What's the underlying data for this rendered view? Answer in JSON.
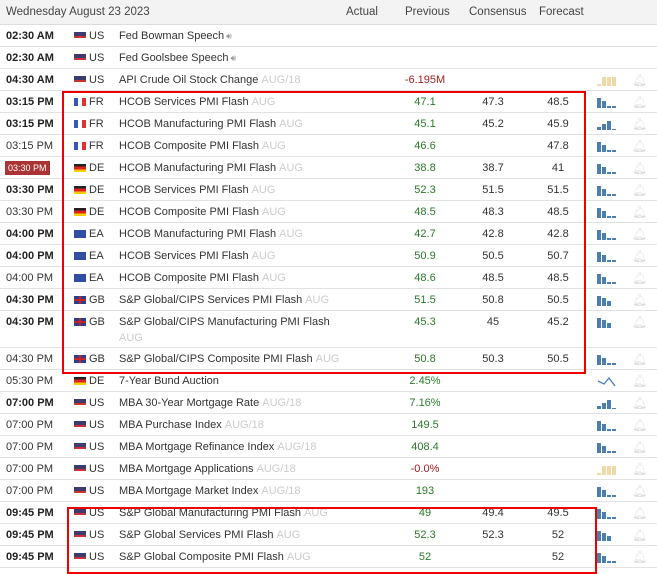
{
  "header": {
    "date": "Wednesday August 23 2023",
    "actual": "Actual",
    "previous": "Previous",
    "consensus": "Consensus",
    "forecast": "Forecast"
  },
  "colors": {
    "highlight_box": "#ee0000",
    "chart_blue": "#4a7fb0",
    "chart_tan": "#f0d9a8",
    "badge": "#aa3333"
  },
  "rows": [
    {
      "time": "02:30 AM",
      "bold": true,
      "cc": "US",
      "event": "Fed Bowman Speech",
      "period": "",
      "speaker": true,
      "previous": "",
      "consensus": "",
      "forecast": "",
      "chart": "none"
    },
    {
      "time": "02:30 AM",
      "bold": true,
      "cc": "US",
      "event": "Fed Goolsbee Speech",
      "period": "",
      "speaker": true,
      "previous": "",
      "consensus": "",
      "forecast": "",
      "chart": "none"
    },
    {
      "time": "04:30 AM",
      "bold": true,
      "cc": "US",
      "event": "API Crude Oil Stock Change",
      "period": "AUG/18",
      "previous": "-6.195M",
      "consensus": "",
      "forecast": "",
      "chart": "tan"
    },
    {
      "time": "03:15 PM",
      "bold": true,
      "cc": "FR",
      "event": "HCOB Services PMI Flash",
      "period": "AUG",
      "previous": "47.1",
      "consensus": "47.3",
      "forecast": "48.5",
      "chart": "bars"
    },
    {
      "time": "03:15 PM",
      "bold": true,
      "cc": "FR",
      "event": "HCOB Manufacturing PMI Flash",
      "period": "AUG",
      "previous": "45.1",
      "consensus": "45.2",
      "forecast": "45.9",
      "chart": "rising"
    },
    {
      "time": "03:15 PM",
      "bold": false,
      "cc": "FR",
      "event": "HCOB Composite PMI Flash",
      "period": "AUG",
      "previous": "46.6",
      "consensus": "",
      "forecast": "47.8",
      "chart": "bars"
    },
    {
      "time": "03:30 PM",
      "badge": true,
      "cc": "DE",
      "event": "HCOB Manufacturing PMI Flash",
      "period": "AUG",
      "previous": "38.8",
      "consensus": "38.7",
      "forecast": "41",
      "chart": "bars"
    },
    {
      "time": "03:30 PM",
      "bold": true,
      "cc": "DE",
      "event": "HCOB Services PMI Flash",
      "period": "AUG",
      "previous": "52.3",
      "consensus": "51.5",
      "forecast": "51.5",
      "chart": "bars"
    },
    {
      "time": "03:30 PM",
      "bold": false,
      "cc": "DE",
      "event": "HCOB Composite PMI Flash",
      "period": "AUG",
      "previous": "48.5",
      "consensus": "48.3",
      "forecast": "48.5",
      "chart": "bars"
    },
    {
      "time": "04:00 PM",
      "bold": true,
      "cc": "EA",
      "event": "HCOB Manufacturing PMI Flash",
      "period": "AUG",
      "previous": "42.7",
      "consensus": "42.8",
      "forecast": "42.8",
      "chart": "bars"
    },
    {
      "time": "04:00 PM",
      "bold": true,
      "cc": "EA",
      "event": "HCOB Services PMI Flash",
      "period": "AUG",
      "previous": "50.9",
      "consensus": "50.5",
      "forecast": "50.7",
      "chart": "bars"
    },
    {
      "time": "04:00 PM",
      "bold": false,
      "cc": "EA",
      "event": "HCOB Composite PMI Flash",
      "period": "AUG",
      "previous": "48.6",
      "consensus": "48.5",
      "forecast": "48.5",
      "chart": "bars"
    },
    {
      "time": "04:30 PM",
      "bold": true,
      "cc": "GB",
      "event": "S&P Global/CIPS Services PMI Flash",
      "period": "AUG",
      "previous": "51.5",
      "consensus": "50.8",
      "forecast": "50.5",
      "chart": "three"
    },
    {
      "time": "04:30 PM",
      "bold": true,
      "tall": true,
      "cc": "GB",
      "event": "S&P Global/CIPS Manufacturing PMI Flash",
      "period": "AUG",
      "previous": "45.3",
      "consensus": "45",
      "forecast": "45.2",
      "chart": "three"
    },
    {
      "time": "04:30 PM",
      "bold": false,
      "cc": "GB",
      "event": "S&P Global/CIPS Composite PMI Flash",
      "period": "AUG",
      "previous": "50.8",
      "consensus": "50.3",
      "forecast": "50.5",
      "chart": "bars"
    },
    {
      "time": "05:30 PM",
      "bold": false,
      "cc": "DE",
      "event": "7-Year Bund Auction",
      "period": "",
      "previous": "2.45%",
      "consensus": "",
      "forecast": "",
      "chart": "line"
    },
    {
      "time": "07:00 PM",
      "bold": true,
      "cc": "US",
      "event": "MBA 30-Year Mortgage Rate",
      "period": "AUG/18",
      "previous": "7.16%",
      "consensus": "",
      "forecast": "",
      "chart": "rising"
    },
    {
      "time": "07:00 PM",
      "bold": false,
      "cc": "US",
      "event": "MBA Purchase Index",
      "period": "AUG/18",
      "previous": "149.5",
      "consensus": "",
      "forecast": "",
      "chart": "bars"
    },
    {
      "time": "07:00 PM",
      "bold": false,
      "cc": "US",
      "event": "MBA Mortgage Refinance Index",
      "period": "AUG/18",
      "previous": "408.4",
      "consensus": "",
      "forecast": "",
      "chart": "bars"
    },
    {
      "time": "07:00 PM",
      "bold": false,
      "cc": "US",
      "event": "MBA Mortgage Applications",
      "period": "AUG/18",
      "previous": "-0.0%",
      "consensus": "",
      "forecast": "",
      "chart": "tan"
    },
    {
      "time": "07:00 PM",
      "bold": false,
      "cc": "US",
      "event": "MBA Mortgage Market Index",
      "period": "AUG/18",
      "previous": "193",
      "consensus": "",
      "forecast": "",
      "chart": "bars"
    },
    {
      "time": "09:45 PM",
      "bold": true,
      "cc": "US",
      "event": "S&P Global Manufacturing PMI Flash",
      "period": "AUG",
      "previous": "49",
      "consensus": "49.4",
      "forecast": "49.5",
      "chart": "bars"
    },
    {
      "time": "09:45 PM",
      "bold": true,
      "cc": "US",
      "event": "S&P Global Services PMI Flash",
      "period": "AUG",
      "previous": "52.3",
      "consensus": "52.3",
      "forecast": "52",
      "chart": "three"
    },
    {
      "time": "09:45 PM",
      "bold": true,
      "cc": "US",
      "event": "S&P Global Composite PMI Flash",
      "period": "AUG",
      "previous": "52",
      "consensus": "",
      "forecast": "52",
      "chart": "bars"
    }
  ]
}
